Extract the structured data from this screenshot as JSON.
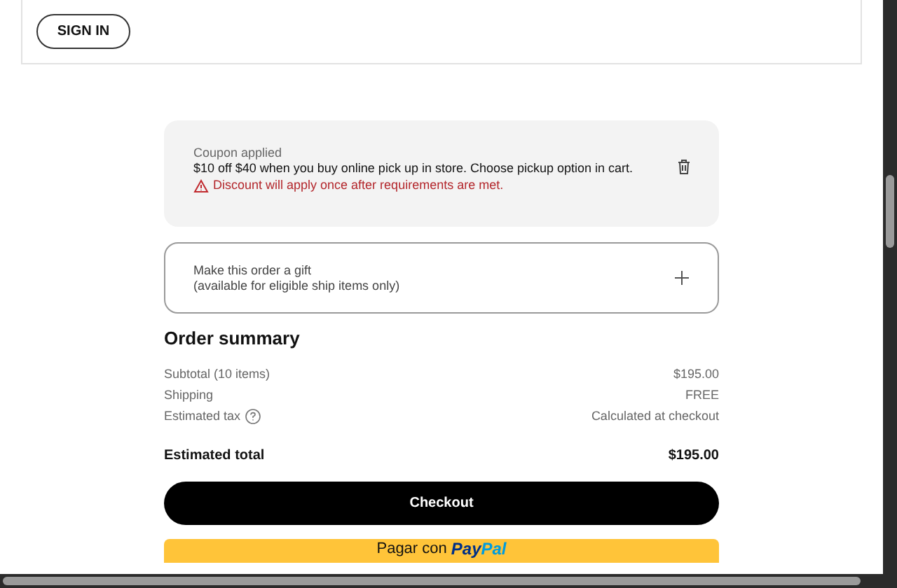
{
  "account": {
    "sign_in_button": "SIGN IN"
  },
  "coupon": {
    "title": "Coupon applied",
    "description": "$10 off $40 when you buy online pick up in store. Choose pickup option in cart.",
    "warning": "Discount will apply once after requirements are met."
  },
  "gift": {
    "title": "Make this order a gift",
    "subtitle": "(available for eligible ship items only)",
    "expanded": false
  },
  "order_summary": {
    "title": "Order summary",
    "rows": [
      {
        "label": "Subtotal (10 items)",
        "value": "$195.00",
        "info": false
      },
      {
        "label": "Shipping",
        "value": "FREE",
        "info": false
      },
      {
        "label": "Estimated tax",
        "value": "Calculated at checkout",
        "info": true
      }
    ],
    "total_label": "Estimated total",
    "total_value": "$195.00"
  },
  "checkout_button": "Checkout",
  "paypal_button": {
    "text": "Pagar con",
    "brand_first": "Pay",
    "brand_second": "Pal"
  }
}
